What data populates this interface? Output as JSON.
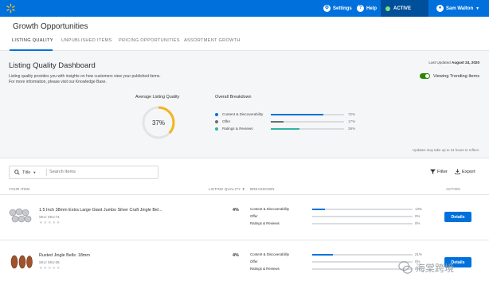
{
  "topbar": {
    "settings_label": "Settings",
    "help_label": "Help",
    "active_label": "ACTIVE",
    "user_name": "Sam Walton"
  },
  "page": {
    "title": "Growth Opportunities"
  },
  "tabs": [
    {
      "label": "LISTING QUALITY",
      "active": true
    },
    {
      "label": "UNPUBLISHED ITEMS",
      "active": false
    },
    {
      "label": "PRICING OPPORTUNITIES",
      "active": false
    },
    {
      "label": "ASSORTMENT GROWTH",
      "active": false
    }
  ],
  "dashboard": {
    "title": "Listing Quality Dashboard",
    "description_1": "Listing quality provides you with insights on how customers view your published items.",
    "description_2": "For more information, please visit our Knowledge Base.",
    "last_updated_label": "Last Updated",
    "last_updated_date": "August 24, 2020",
    "toggle_label": "Viewing Trending Items",
    "avg_label": "Average Listing Quality",
    "avg_value": "37%",
    "avg_fraction": 0.37,
    "breakdown_label": "Overall Breakdown",
    "breakdown": [
      {
        "name": "Content & Discoverability",
        "pct": "72%",
        "value": 0.72,
        "color": "#0071dc"
      },
      {
        "name": "Offer",
        "pct": "17%",
        "value": 0.17,
        "color": "#6d6e71"
      },
      {
        "name": "Ratings & Reviews",
        "pct": "39%",
        "value": 0.39,
        "color": "#2fb5a0"
      }
    ],
    "update_note": "Updates may take up to 24 hours to reflect."
  },
  "toolbar": {
    "search_type": "Title",
    "search_placeholder": "Search Items",
    "filter_label": "Filter",
    "export_label": "Export"
  },
  "table": {
    "headers": {
      "item": "YOUR ITEM",
      "quality": "LISTING QUALITY",
      "breakdown": "BREAKDOWN",
      "action": "ACTION"
    },
    "rows": [
      {
        "name": "1.5 Inch 38mm Extra Large Giant Jumbo Silver Craft Jingle Bel...",
        "sku": "SKU: SKU-74",
        "quality": "4%",
        "breakdown": [
          {
            "name": "Content & Discoverability",
            "pct": "13%",
            "value": 0.13
          },
          {
            "name": "Offer",
            "pct": "0%",
            "value": 0
          },
          {
            "name": "Ratings & Reviews",
            "pct": "0%",
            "value": 0
          }
        ],
        "action_label": "Details"
      },
      {
        "name": "Rusted Jingle Bells: 18mm",
        "sku": "SKU: SKU-36",
        "quality": "4%",
        "breakdown": [
          {
            "name": "Content & Discoverability",
            "pct": "21%",
            "value": 0.21
          },
          {
            "name": "Offer",
            "pct": "0%",
            "value": 0
          },
          {
            "name": "Ratings & Reviews",
            "pct": "0%",
            "value": 0
          }
        ],
        "action_label": "Details"
      }
    ]
  },
  "watermark": {
    "text": "海棠跨境"
  },
  "colors": {
    "brand": "#0071dc",
    "toggle": "#2a8703",
    "gauge": "#f2b51b"
  }
}
